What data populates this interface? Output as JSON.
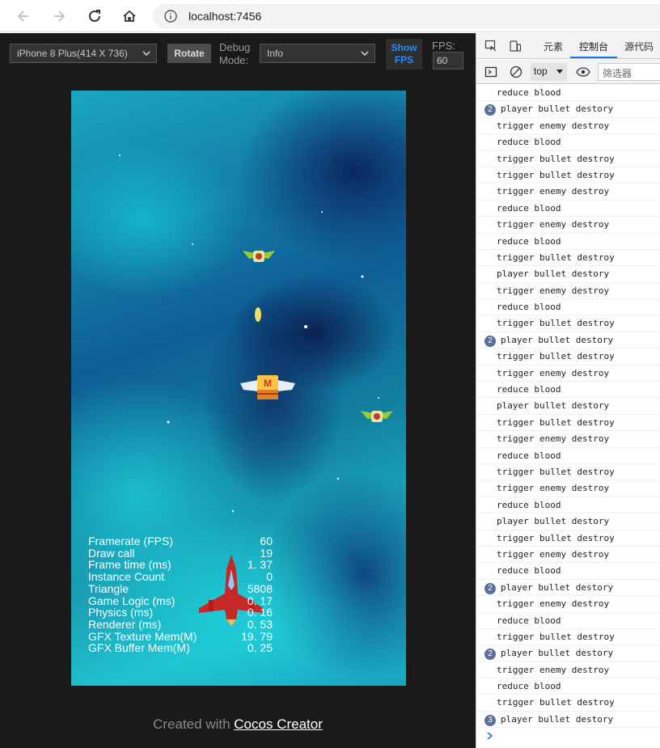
{
  "browser": {
    "url": "localhost:7456"
  },
  "toolbar": {
    "device_select": "iPhone 8 Plus(414 X 736)",
    "rotate_label": "Rotate",
    "debug_label_1": "Debug",
    "debug_label_2": "Mode:",
    "debug_select": "Info",
    "show_fps_1": "Show",
    "show_fps_2": "FPS",
    "fps_label": "FPS:",
    "fps_value": "60"
  },
  "stats": [
    {
      "label": "Framerate (FPS)",
      "value": "60"
    },
    {
      "label": "Draw call",
      "value": "19"
    },
    {
      "label": "Frame time (ms)",
      "value": "1. 37"
    },
    {
      "label": "Instance Count",
      "value": "0"
    },
    {
      "label": "Triangle",
      "value": "5808"
    },
    {
      "label": "Game Logic (ms)",
      "value": "0. 17"
    },
    {
      "label": "Physics (ms)",
      "value": "0. 16"
    },
    {
      "label": "Renderer (ms)",
      "value": "0. 53"
    },
    {
      "label": "GFX Texture Mem(M)",
      "value": "19. 79"
    },
    {
      "label": "GFX Buffer Mem(M)",
      "value": "0. 25"
    }
  ],
  "footer": {
    "prefix": "Created with ",
    "link": "Cocos Creator"
  },
  "devtools": {
    "tabs": [
      "元素",
      "控制台",
      "源代码"
    ],
    "context": "top",
    "filter_placeholder": "筛选器",
    "logs": [
      {
        "text": "reduce blood",
        "count": ""
      },
      {
        "text": "player bullet destory",
        "count": "2"
      },
      {
        "text": "trigger enemy destroy",
        "count": ""
      },
      {
        "text": "reduce blood",
        "count": ""
      },
      {
        "text": "trigger bullet destroy",
        "count": ""
      },
      {
        "text": "trigger bullet destroy",
        "count": ""
      },
      {
        "text": "trigger enemy destroy",
        "count": ""
      },
      {
        "text": "reduce blood",
        "count": ""
      },
      {
        "text": "trigger enemy destroy",
        "count": ""
      },
      {
        "text": "reduce blood",
        "count": ""
      },
      {
        "text": "trigger bullet destroy",
        "count": ""
      },
      {
        "text": "player bullet destory",
        "count": ""
      },
      {
        "text": "trigger enemy destroy",
        "count": ""
      },
      {
        "text": "reduce blood",
        "count": ""
      },
      {
        "text": "trigger bullet destroy",
        "count": ""
      },
      {
        "text": "player bullet destory",
        "count": "2"
      },
      {
        "text": "trigger bullet destroy",
        "count": ""
      },
      {
        "text": "trigger enemy destroy",
        "count": ""
      },
      {
        "text": "reduce blood",
        "count": ""
      },
      {
        "text": "player bullet destory",
        "count": ""
      },
      {
        "text": "trigger bullet destroy",
        "count": ""
      },
      {
        "text": "trigger enemy destroy",
        "count": ""
      },
      {
        "text": "reduce blood",
        "count": ""
      },
      {
        "text": "trigger bullet destroy",
        "count": ""
      },
      {
        "text": "trigger enemy destroy",
        "count": ""
      },
      {
        "text": "reduce blood",
        "count": ""
      },
      {
        "text": "player bullet destory",
        "count": ""
      },
      {
        "text": "trigger bullet destroy",
        "count": ""
      },
      {
        "text": "trigger enemy destroy",
        "count": ""
      },
      {
        "text": "reduce blood",
        "count": ""
      },
      {
        "text": "player bullet destory",
        "count": "2"
      },
      {
        "text": "trigger enemy destroy",
        "count": ""
      },
      {
        "text": "reduce blood",
        "count": ""
      },
      {
        "text": "trigger bullet destroy",
        "count": ""
      },
      {
        "text": "player bullet destory",
        "count": "2"
      },
      {
        "text": "trigger enemy destroy",
        "count": ""
      },
      {
        "text": "reduce blood",
        "count": ""
      },
      {
        "text": "trigger bullet destroy",
        "count": ""
      },
      {
        "text": "player bullet destory",
        "count": "3"
      }
    ]
  }
}
